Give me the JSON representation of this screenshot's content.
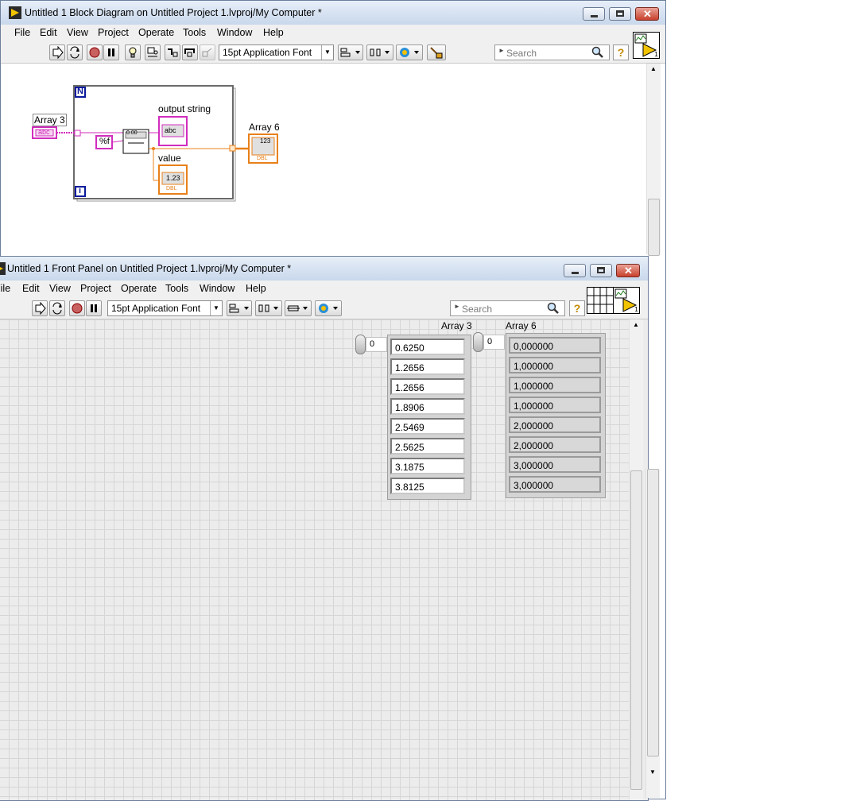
{
  "block_diagram": {
    "title": "Untitled 1 Block Diagram on Untitled Project 1.lvproj/My Computer *",
    "menu": [
      "File",
      "Edit",
      "View",
      "Project",
      "Operate",
      "Tools",
      "Window",
      "Help"
    ],
    "font_selector": "15pt Application Font",
    "search_placeholder": "Search",
    "help_label": "?",
    "diagram": {
      "loop_count_label": "N",
      "loop_index_label": "i",
      "array_in_label": "Array 3",
      "array_in_terminal": "abc",
      "format_constant": "%f",
      "output_string_label": "output string",
      "output_string_terminal": "abc",
      "value_label": "value",
      "value_terminal": "1.23",
      "value_type": "DBL",
      "array_out_label": "Array 6",
      "array_out_terminal": "123",
      "array_out_type": "DBL",
      "scan_node_text": "0.00",
      "colors": {
        "string_wire": "#d12dbe",
        "dbl_wire": "#e8801a",
        "loop_border": "#0a1a9c"
      }
    }
  },
  "front_panel": {
    "title": "Untitled 1 Front Panel on Untitled Project 1.lvproj/My Computer *",
    "menu": [
      "File",
      "Edit",
      "View",
      "Project",
      "Operate",
      "Tools",
      "Window",
      "Help"
    ],
    "font_selector": "15pt Application Font",
    "search_placeholder": "Search",
    "help_label": "?",
    "array3": {
      "label": "Array 3",
      "index": "0",
      "values": [
        "0.6250",
        "1.2656",
        "1.2656",
        "1.8906",
        "2.5469",
        "2.5625",
        "3.1875",
        "3.8125"
      ]
    },
    "array6": {
      "label": "Array 6",
      "index": "0",
      "values": [
        "0,000000",
        "1,000000",
        "1,000000",
        "1,000000",
        "2,000000",
        "2,000000",
        "3,000000",
        "3,000000"
      ]
    }
  }
}
